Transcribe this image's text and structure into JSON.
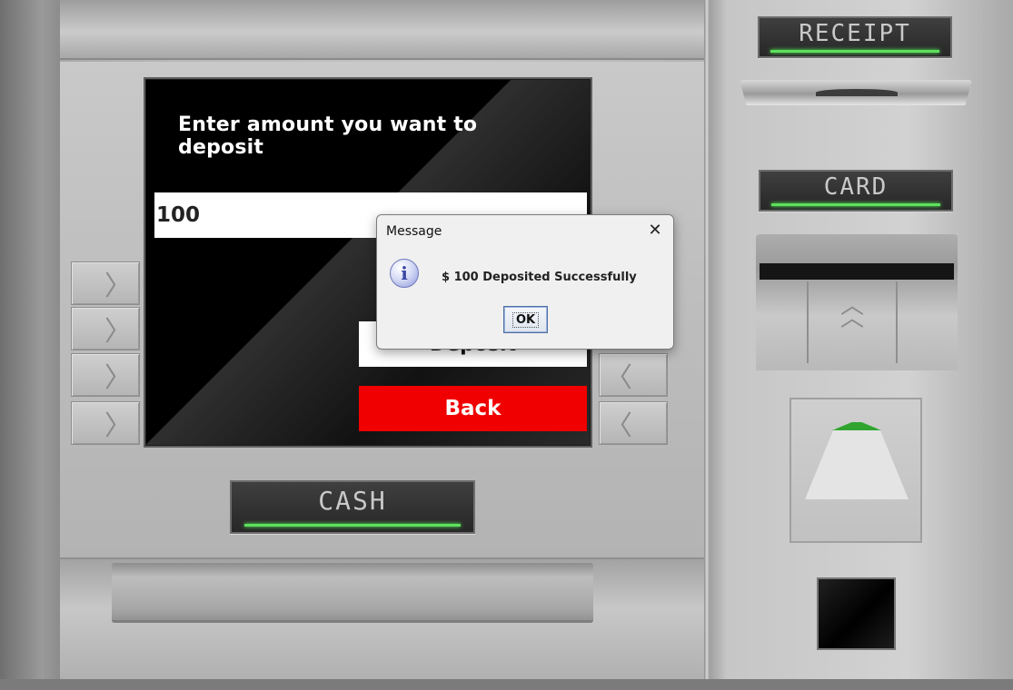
{
  "screen": {
    "prompt": "Enter amount you want to deposit",
    "amount_value": "100",
    "deposit_label": "Deposit",
    "back_label": "Back"
  },
  "panels": {
    "receipt_label": "RECEIPT",
    "card_label": "CARD",
    "cash_label": "CASH"
  },
  "dialog": {
    "title": "Message",
    "close_glyph": "✕",
    "icon_glyph": "i",
    "message": "$ 100 Deposited Successfully",
    "ok_label": "OK"
  },
  "side_keys": {
    "left_glyph": "〉",
    "right_glyph": "〈"
  },
  "colors": {
    "back_button": "#f00000",
    "led": "#5de05d",
    "screen": "#000000"
  }
}
